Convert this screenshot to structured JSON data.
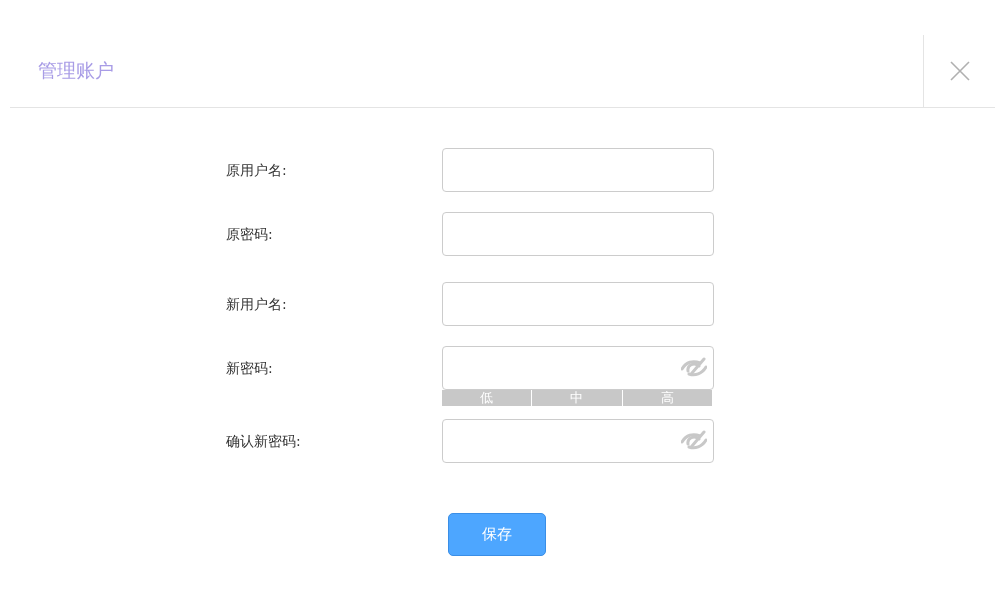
{
  "dialog": {
    "title": "管理账户"
  },
  "fields": [
    {
      "label": "原用户名:",
      "kind": "text"
    },
    {
      "label": "原密码:",
      "kind": "text"
    },
    {
      "label": "新用户名:",
      "kind": "text"
    },
    {
      "label": "新密码:",
      "kind": "password",
      "strength": [
        "低",
        "中",
        "高"
      ]
    },
    {
      "label": "确认新密码:",
      "kind": "password"
    }
  ],
  "buttons": [
    "保存"
  ]
}
